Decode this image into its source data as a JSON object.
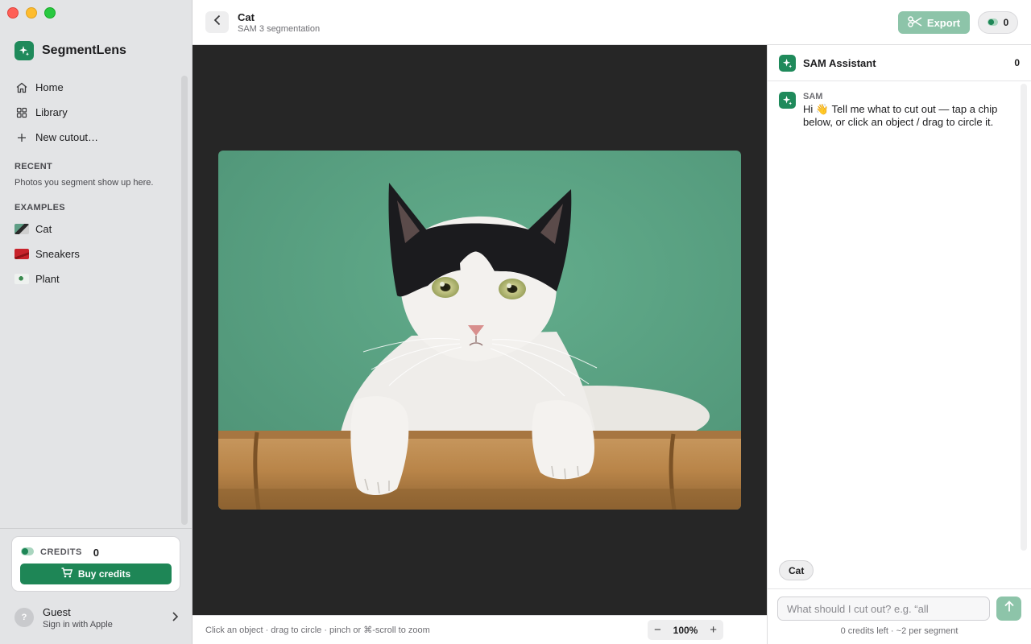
{
  "sidebar": {
    "brand_name": "SegmentLens",
    "nav": [
      {
        "label": "Home",
        "icon": "home-icon"
      },
      {
        "label": "Library",
        "icon": "grid-icon"
      },
      {
        "label": "New cutout…",
        "icon": "plus-icon"
      }
    ],
    "recent_label": "RECENT",
    "recent_note": "Photos you segment show up here.",
    "examples_label": "EXAMPLES",
    "examples": [
      {
        "label": "Cat",
        "thumb_color": "#5f9e86"
      },
      {
        "label": "Sneakers",
        "thumb_color": "#c8222b"
      },
      {
        "label": "Plant",
        "thumb_color": "#e8ece9"
      }
    ],
    "credits": {
      "label": "CREDITS",
      "count": "0",
      "buy_label": "Buy credits"
    },
    "user": {
      "avatar": "?",
      "name": "Guest",
      "sub": "Sign in with Apple"
    }
  },
  "header": {
    "title": "Cat",
    "subtitle": "SAM 3 segmentation",
    "export_label": "Export",
    "credit_pill": "0"
  },
  "canvas": {
    "image_subject": "cat"
  },
  "statusbar": {
    "hint": "Click an object · drag to circle · pinch or ⌘-scroll to zoom",
    "zoom_minus": "−",
    "zoom_level": "100%",
    "zoom_plus": "+"
  },
  "panel": {
    "title": "SAM Assistant",
    "count": "0",
    "message": {
      "sender": "SAM",
      "text": "Hi 👋 Tell me what to cut out — tap a chip below, or click an object / drag to circle it."
    },
    "chip": "Cat",
    "input_placeholder": "What should I cut out? e.g. “all",
    "footnote": "0 credits left · ~2 per segment"
  },
  "colors": {
    "accent": "#1e8656",
    "accent_disabled": "#8dc4a9",
    "sidebar_bg": "#e3e4e6",
    "canvas_bg": "#262626"
  }
}
